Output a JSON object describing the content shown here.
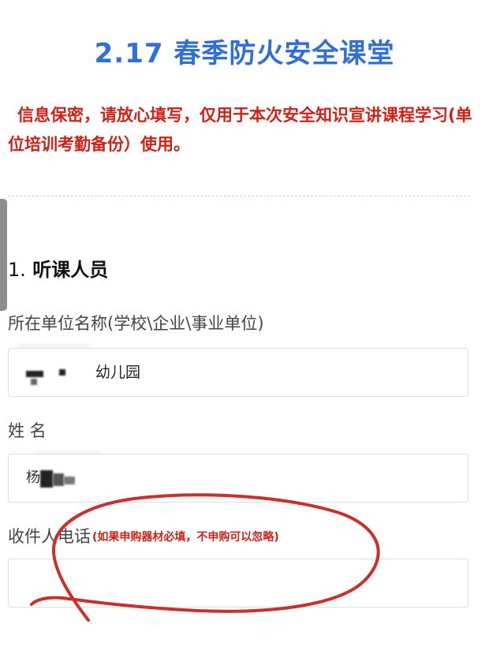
{
  "page": {
    "title": "2.17 春季防火安全课堂",
    "notice": "信息保密，请放心填写，仅用于本次安全知识宣讲课程学习(单位培训考勤备份）使用。"
  },
  "section": {
    "number": "1.",
    "title": "听课人员"
  },
  "fields": {
    "unit": {
      "label": "所在单位名称(学校\\企业\\事业单位)",
      "value": "幼儿园"
    },
    "name": {
      "label": "姓 名",
      "value_prefix": "杨"
    },
    "phone": {
      "label": "收件人电话",
      "hint": "(如果申购器材必填，不申购可以忽略)",
      "value": ""
    }
  },
  "colors": {
    "title": "#2f6fd6",
    "notice": "#cc2218",
    "annotation": "#c8302a"
  }
}
